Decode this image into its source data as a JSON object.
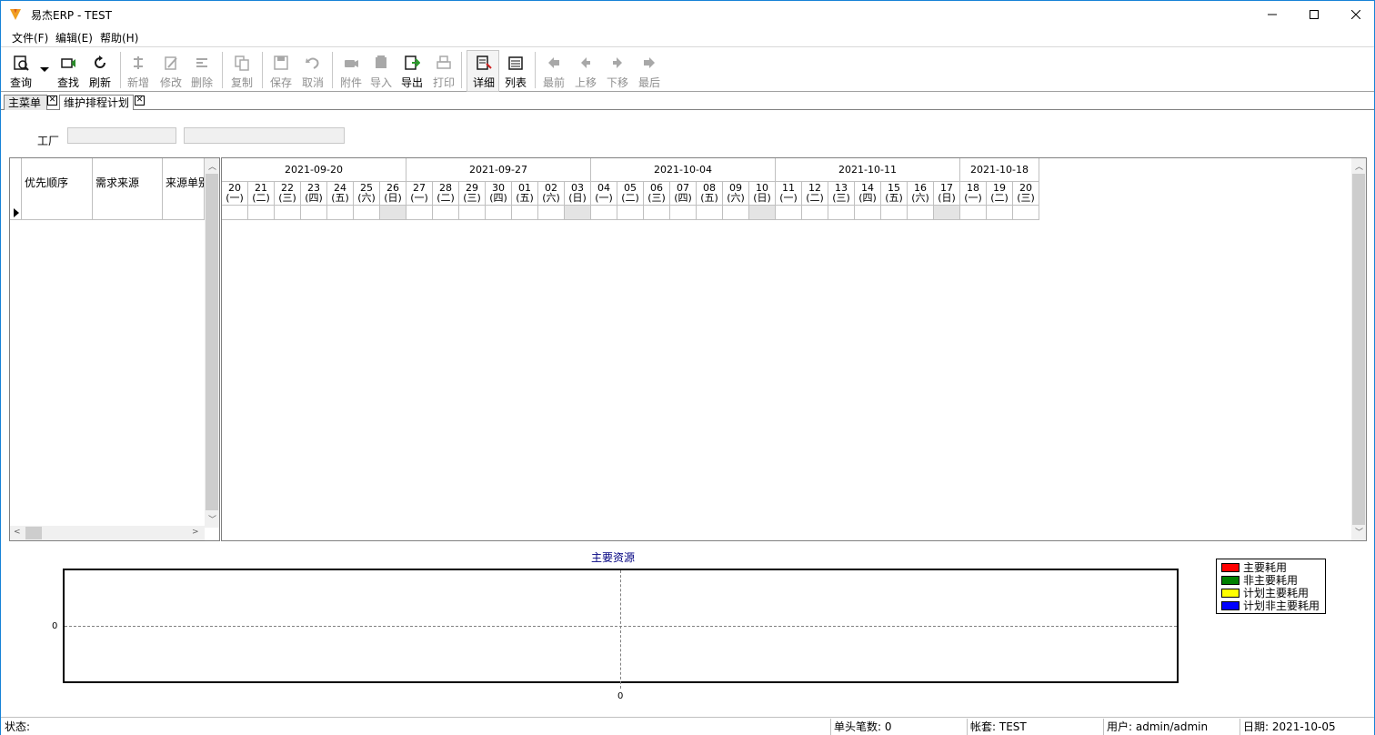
{
  "window": {
    "title": "易杰ERP - TEST"
  },
  "menu": [
    "文件(F)",
    "编辑(E)",
    "帮助(H)"
  ],
  "toolbar": [
    {
      "label": "查询",
      "icon": "query-icon",
      "enabled": true
    },
    {
      "label": "查找",
      "icon": "find-icon",
      "enabled": true
    },
    {
      "label": "刷新",
      "icon": "refresh-icon",
      "enabled": true
    },
    {
      "label": "新增",
      "icon": "add-icon",
      "enabled": false
    },
    {
      "label": "修改",
      "icon": "edit-icon",
      "enabled": false
    },
    {
      "label": "删除",
      "icon": "delete-icon",
      "enabled": false
    },
    {
      "label": "复制",
      "icon": "copy-icon",
      "enabled": false
    },
    {
      "label": "保存",
      "icon": "save-icon",
      "enabled": false
    },
    {
      "label": "取消",
      "icon": "undo-icon",
      "enabled": false
    },
    {
      "label": "附件",
      "icon": "attachment-icon",
      "enabled": false
    },
    {
      "label": "导入",
      "icon": "import-icon",
      "enabled": false
    },
    {
      "label": "导出",
      "icon": "export-icon",
      "enabled": true
    },
    {
      "label": "打印",
      "icon": "print-icon",
      "enabled": false
    },
    {
      "label": "详细",
      "icon": "detail-icon",
      "enabled": true,
      "active": true
    },
    {
      "label": "列表",
      "icon": "list-icon",
      "enabled": true
    },
    {
      "label": "最前",
      "icon": "first-icon",
      "enabled": false
    },
    {
      "label": "上移",
      "icon": "prev-icon",
      "enabled": false
    },
    {
      "label": "下移",
      "icon": "next-icon",
      "enabled": false
    },
    {
      "label": "最后",
      "icon": "last-icon",
      "enabled": false
    }
  ],
  "tabs": [
    {
      "label": "主菜单",
      "active": false
    },
    {
      "label": "维护排程计划",
      "active": true
    }
  ],
  "factory": {
    "label": "工厂",
    "code": "",
    "name": ""
  },
  "left_grid": {
    "columns": [
      "优先顺序",
      "需求来源",
      "来源单别"
    ]
  },
  "schedule": {
    "weeks": [
      "2021-09-20",
      "2021-09-27",
      "2021-10-04",
      "2021-10-11",
      "2021-10-18"
    ],
    "days": [
      {
        "day": "20",
        "wd": "(一)"
      },
      {
        "day": "21",
        "wd": "(二)"
      },
      {
        "day": "22",
        "wd": "(三)"
      },
      {
        "day": "23",
        "wd": "(四)"
      },
      {
        "day": "24",
        "wd": "(五)"
      },
      {
        "day": "25",
        "wd": "(六)"
      },
      {
        "day": "26",
        "wd": "(日)"
      },
      {
        "day": "27",
        "wd": "(一)"
      },
      {
        "day": "28",
        "wd": "(二)"
      },
      {
        "day": "29",
        "wd": "(三)"
      },
      {
        "day": "30",
        "wd": "(四)"
      },
      {
        "day": "01",
        "wd": "(五)"
      },
      {
        "day": "02",
        "wd": "(六)"
      },
      {
        "day": "03",
        "wd": "(日)"
      },
      {
        "day": "04",
        "wd": "(一)"
      },
      {
        "day": "05",
        "wd": "(二)"
      },
      {
        "day": "06",
        "wd": "(三)"
      },
      {
        "day": "07",
        "wd": "(四)"
      },
      {
        "day": "08",
        "wd": "(五)"
      },
      {
        "day": "09",
        "wd": "(六)"
      },
      {
        "day": "10",
        "wd": "(日)"
      },
      {
        "day": "11",
        "wd": "(一)"
      },
      {
        "day": "12",
        "wd": "(二)"
      },
      {
        "day": "13",
        "wd": "(三)"
      },
      {
        "day": "14",
        "wd": "(四)"
      },
      {
        "day": "15",
        "wd": "(五)"
      },
      {
        "day": "16",
        "wd": "(六)"
      },
      {
        "day": "17",
        "wd": "(日)"
      },
      {
        "day": "18",
        "wd": "(一)"
      },
      {
        "day": "19",
        "wd": "(二)"
      },
      {
        "day": "20",
        "wd": "(三)"
      }
    ]
  },
  "chart_data": {
    "type": "bar",
    "title": "主要资源",
    "y_tick": "0",
    "x_tick": "0",
    "series": [
      {
        "name": "主要耗用",
        "color": "#ff0000",
        "values": []
      },
      {
        "name": "非主要耗用",
        "color": "#008000",
        "values": []
      },
      {
        "name": "计划主要耗用",
        "color": "#ffff00",
        "values": []
      },
      {
        "name": "计划非主要耗用",
        "color": "#0000ff",
        "values": []
      }
    ]
  },
  "status": {
    "state": "状态:",
    "count": "单头笔数: 0",
    "account": "帐套: TEST",
    "user": "用户: admin/admin",
    "date": "日期: 2021-10-05"
  }
}
